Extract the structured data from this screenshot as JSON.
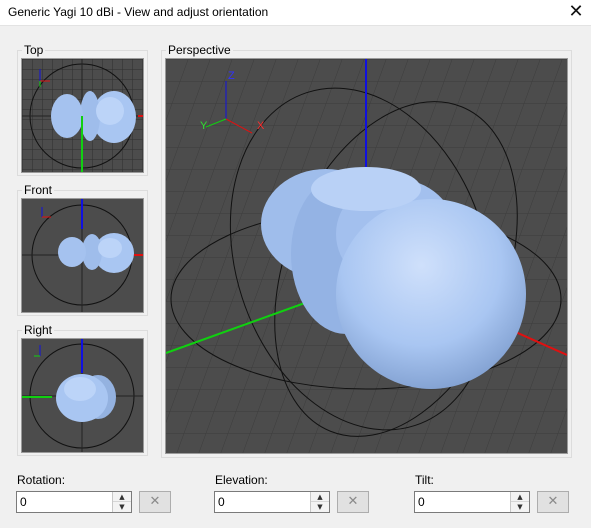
{
  "window": {
    "title": "Generic Yagi 10 dBi - View and adjust orientation",
    "close_glyph": "✕"
  },
  "views": {
    "top": "Top",
    "front": "Front",
    "right": "Right",
    "perspective": "Perspective"
  },
  "axes": {
    "x": "X",
    "y": "Y",
    "z": "Z"
  },
  "controls": {
    "rotation": {
      "label": "Rotation:",
      "value": "0"
    },
    "elevation": {
      "label": "Elevation:",
      "value": "0"
    },
    "tilt": {
      "label": "Tilt:",
      "value": "0"
    },
    "reset_glyph": "✕",
    "up_glyph": "▲",
    "down_glyph": "▼"
  },
  "colors": {
    "viewport_bg": "#4c4c4c",
    "grid": "#333333",
    "lobe": "#a9c6f2",
    "x_axis": "#e01010",
    "y_axis": "#10d010",
    "z_axis": "#1010e0"
  }
}
